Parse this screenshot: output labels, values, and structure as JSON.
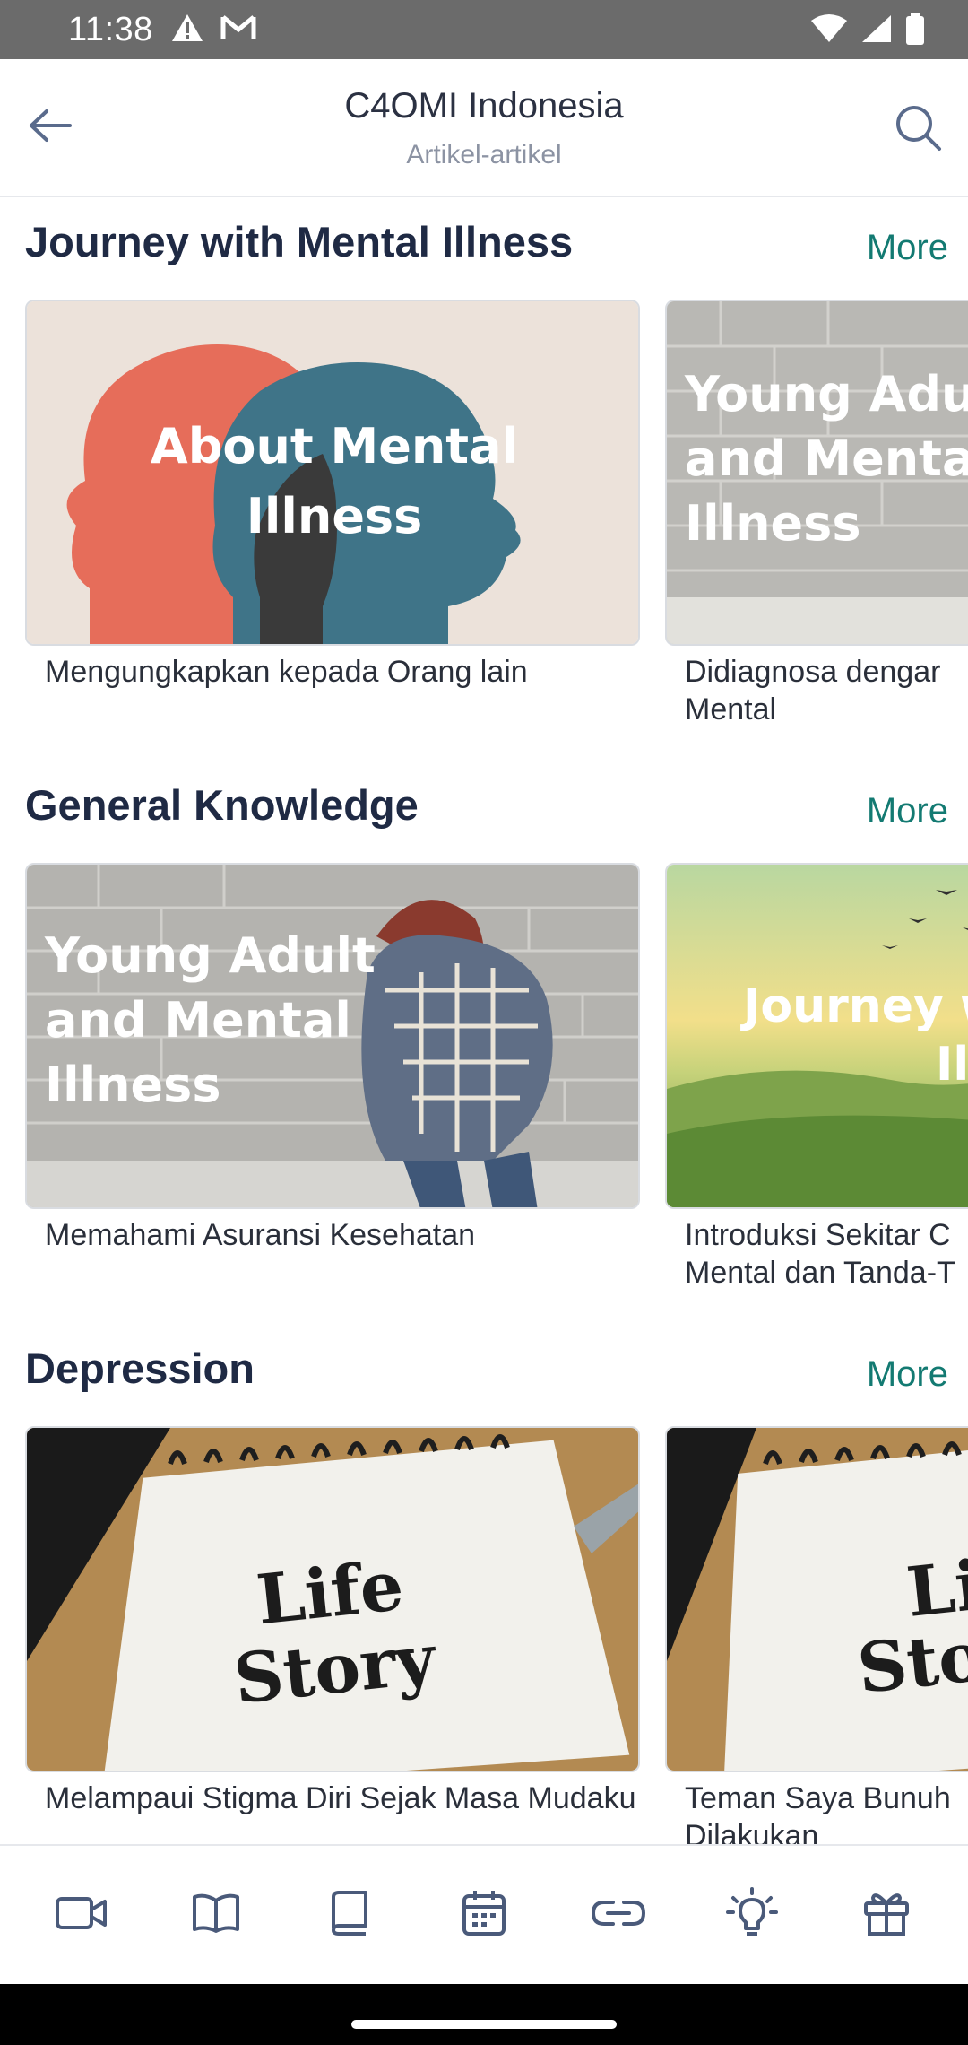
{
  "status_bar": {
    "time": "11:38",
    "left_icons": [
      "warning-icon",
      "gmail-icon"
    ],
    "right_icons": [
      "wifi-icon",
      "signal-icon",
      "battery-icon"
    ]
  },
  "header": {
    "title": "C4OMI Indonesia",
    "subtitle": "Artikel-artikel",
    "back_icon": "arrow-left-icon",
    "search_icon": "search-icon"
  },
  "sections": [
    {
      "title": "Journey with Mental Illness",
      "more_label": "More",
      "cards": [
        {
          "image_text": [
            "About Mental",
            "Illness"
          ],
          "caption": "Mengungkapkan kepada Orang lain"
        },
        {
          "image_text": [
            "Young Adu",
            "and Menta",
            "Illness"
          ],
          "caption": "Didiagnosa dengar Mental"
        }
      ]
    },
    {
      "title": "General Knowledge",
      "more_label": "More",
      "cards": [
        {
          "image_text": [
            "Young Adult",
            "and Mental",
            "Illness"
          ],
          "caption": "Memahami Asuransi Kesehatan"
        },
        {
          "image_text": [
            "Journey w",
            "Illn"
          ],
          "caption": "Introduksi Sekitar C Mental dan Tanda-T"
        }
      ]
    },
    {
      "title": "Depression",
      "more_label": "More",
      "cards": [
        {
          "image_text": [
            "Life",
            "Story"
          ],
          "caption": "Melampaui Stigma Diri Sejak Masa Mudaku"
        },
        {
          "image_text": [
            "Li",
            "Sto"
          ],
          "caption": "Teman Saya Bunuh Dilakukan"
        }
      ]
    }
  ],
  "bottom_nav": [
    {
      "icon": "video-icon"
    },
    {
      "icon": "open-book-icon"
    },
    {
      "icon": "book-icon"
    },
    {
      "icon": "calendar-icon"
    },
    {
      "icon": "link-icon"
    },
    {
      "icon": "lightbulb-icon"
    },
    {
      "icon": "gift-icon"
    }
  ],
  "colors": {
    "accent": "#137a72",
    "title": "#1f2a44",
    "status_bar": "#6b6b6b",
    "icon": "#4a5a7a"
  }
}
